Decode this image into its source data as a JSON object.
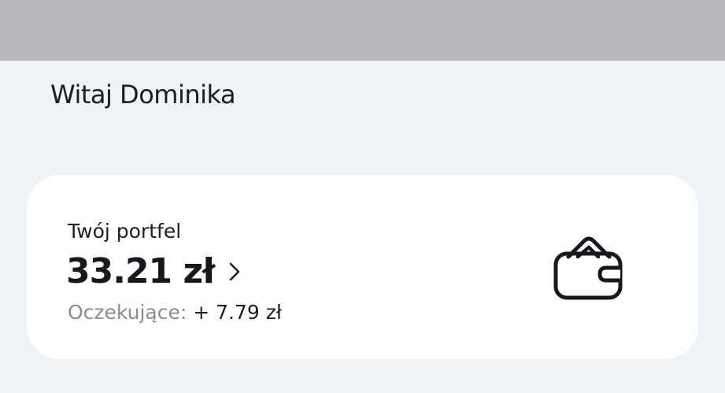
{
  "greeting": "Witaj Dominika",
  "wallet_card": {
    "title": "Twój portfel",
    "balance": "33.21 zł",
    "pending_label": "Oczekujące:",
    "pending_value": "+ 7.79 zł",
    "icon": "wallet-icon",
    "chevron_icon": "chevron-right-icon"
  },
  "colors": {
    "top_bar": "#b5b7bb",
    "background": "#eff3f8",
    "card": "#ffffff",
    "text_primary": "#16181d",
    "text_secondary": "#8a8d94"
  }
}
